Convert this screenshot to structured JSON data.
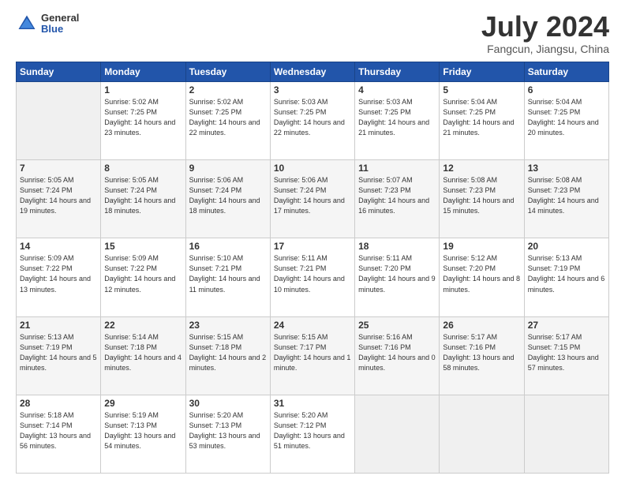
{
  "header": {
    "logo": {
      "general": "General",
      "blue": "Blue"
    },
    "title": "July 2024",
    "location": "Fangcun, Jiangsu, China"
  },
  "days_of_week": [
    "Sunday",
    "Monday",
    "Tuesday",
    "Wednesday",
    "Thursday",
    "Friday",
    "Saturday"
  ],
  "weeks": [
    [
      {
        "day": "",
        "info": ""
      },
      {
        "day": "1",
        "info": "Sunrise: 5:02 AM\nSunset: 7:25 PM\nDaylight: 14 hours\nand 23 minutes."
      },
      {
        "day": "2",
        "info": "Sunrise: 5:02 AM\nSunset: 7:25 PM\nDaylight: 14 hours\nand 22 minutes."
      },
      {
        "day": "3",
        "info": "Sunrise: 5:03 AM\nSunset: 7:25 PM\nDaylight: 14 hours\nand 22 minutes."
      },
      {
        "day": "4",
        "info": "Sunrise: 5:03 AM\nSunset: 7:25 PM\nDaylight: 14 hours\nand 21 minutes."
      },
      {
        "day": "5",
        "info": "Sunrise: 5:04 AM\nSunset: 7:25 PM\nDaylight: 14 hours\nand 21 minutes."
      },
      {
        "day": "6",
        "info": "Sunrise: 5:04 AM\nSunset: 7:25 PM\nDaylight: 14 hours\nand 20 minutes."
      }
    ],
    [
      {
        "day": "7",
        "info": "Sunrise: 5:05 AM\nSunset: 7:24 PM\nDaylight: 14 hours\nand 19 minutes."
      },
      {
        "day": "8",
        "info": "Sunrise: 5:05 AM\nSunset: 7:24 PM\nDaylight: 14 hours\nand 18 minutes."
      },
      {
        "day": "9",
        "info": "Sunrise: 5:06 AM\nSunset: 7:24 PM\nDaylight: 14 hours\nand 18 minutes."
      },
      {
        "day": "10",
        "info": "Sunrise: 5:06 AM\nSunset: 7:24 PM\nDaylight: 14 hours\nand 17 minutes."
      },
      {
        "day": "11",
        "info": "Sunrise: 5:07 AM\nSunset: 7:23 PM\nDaylight: 14 hours\nand 16 minutes."
      },
      {
        "day": "12",
        "info": "Sunrise: 5:08 AM\nSunset: 7:23 PM\nDaylight: 14 hours\nand 15 minutes."
      },
      {
        "day": "13",
        "info": "Sunrise: 5:08 AM\nSunset: 7:23 PM\nDaylight: 14 hours\nand 14 minutes."
      }
    ],
    [
      {
        "day": "14",
        "info": "Sunrise: 5:09 AM\nSunset: 7:22 PM\nDaylight: 14 hours\nand 13 minutes."
      },
      {
        "day": "15",
        "info": "Sunrise: 5:09 AM\nSunset: 7:22 PM\nDaylight: 14 hours\nand 12 minutes."
      },
      {
        "day": "16",
        "info": "Sunrise: 5:10 AM\nSunset: 7:21 PM\nDaylight: 14 hours\nand 11 minutes."
      },
      {
        "day": "17",
        "info": "Sunrise: 5:11 AM\nSunset: 7:21 PM\nDaylight: 14 hours\nand 10 minutes."
      },
      {
        "day": "18",
        "info": "Sunrise: 5:11 AM\nSunset: 7:20 PM\nDaylight: 14 hours\nand 9 minutes."
      },
      {
        "day": "19",
        "info": "Sunrise: 5:12 AM\nSunset: 7:20 PM\nDaylight: 14 hours\nand 8 minutes."
      },
      {
        "day": "20",
        "info": "Sunrise: 5:13 AM\nSunset: 7:19 PM\nDaylight: 14 hours\nand 6 minutes."
      }
    ],
    [
      {
        "day": "21",
        "info": "Sunrise: 5:13 AM\nSunset: 7:19 PM\nDaylight: 14 hours\nand 5 minutes."
      },
      {
        "day": "22",
        "info": "Sunrise: 5:14 AM\nSunset: 7:18 PM\nDaylight: 14 hours\nand 4 minutes."
      },
      {
        "day": "23",
        "info": "Sunrise: 5:15 AM\nSunset: 7:18 PM\nDaylight: 14 hours\nand 2 minutes."
      },
      {
        "day": "24",
        "info": "Sunrise: 5:15 AM\nSunset: 7:17 PM\nDaylight: 14 hours\nand 1 minute."
      },
      {
        "day": "25",
        "info": "Sunrise: 5:16 AM\nSunset: 7:16 PM\nDaylight: 14 hours\nand 0 minutes."
      },
      {
        "day": "26",
        "info": "Sunrise: 5:17 AM\nSunset: 7:16 PM\nDaylight: 13 hours\nand 58 minutes."
      },
      {
        "day": "27",
        "info": "Sunrise: 5:17 AM\nSunset: 7:15 PM\nDaylight: 13 hours\nand 57 minutes."
      }
    ],
    [
      {
        "day": "28",
        "info": "Sunrise: 5:18 AM\nSunset: 7:14 PM\nDaylight: 13 hours\nand 56 minutes."
      },
      {
        "day": "29",
        "info": "Sunrise: 5:19 AM\nSunset: 7:13 PM\nDaylight: 13 hours\nand 54 minutes."
      },
      {
        "day": "30",
        "info": "Sunrise: 5:20 AM\nSunset: 7:13 PM\nDaylight: 13 hours\nand 53 minutes."
      },
      {
        "day": "31",
        "info": "Sunrise: 5:20 AM\nSunset: 7:12 PM\nDaylight: 13 hours\nand 51 minutes."
      },
      {
        "day": "",
        "info": ""
      },
      {
        "day": "",
        "info": ""
      },
      {
        "day": "",
        "info": ""
      }
    ]
  ]
}
